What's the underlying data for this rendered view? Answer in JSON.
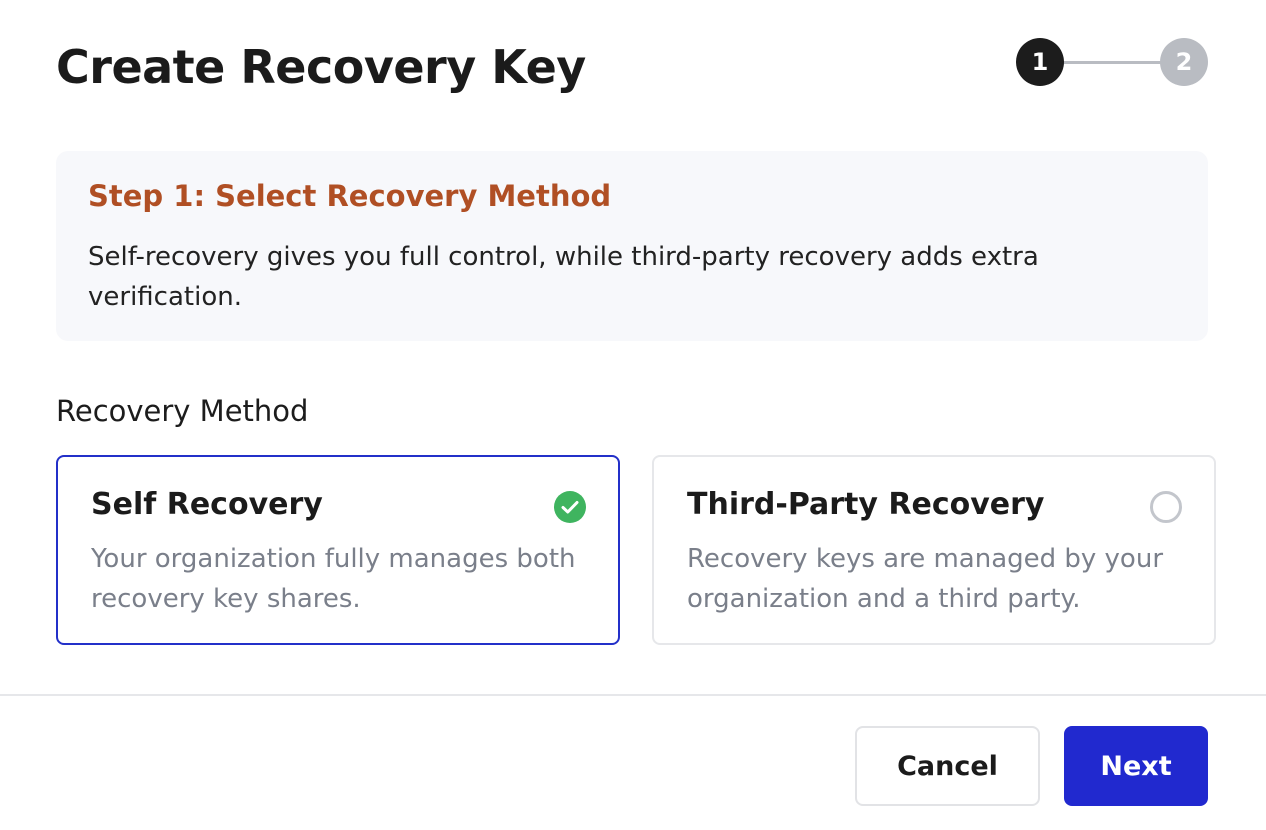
{
  "dialog": {
    "title": "Create Recovery Key"
  },
  "stepper": {
    "steps": [
      {
        "number": "1",
        "state": "active"
      },
      {
        "number": "2",
        "state": "inactive"
      }
    ]
  },
  "info": {
    "heading": "Step 1: Select Recovery Method",
    "text": "Self-recovery gives you full control, while third-party recovery adds extra verification."
  },
  "recovery_method": {
    "label": "Recovery Method",
    "options": [
      {
        "title": "Self Recovery",
        "description": "Your organization fully manages both recovery key shares.",
        "selected": true,
        "icon": "check-circle-icon"
      },
      {
        "title": "Third-Party Recovery",
        "description": "Recovery keys are managed by your organization and a third party.",
        "selected": false,
        "icon": "radio-empty-icon"
      }
    ]
  },
  "footer": {
    "cancel_label": "Cancel",
    "next_label": "Next"
  },
  "colors": {
    "accent": "#2129cf",
    "heading_accent": "#b04f24",
    "success": "#3fb45f",
    "step_active": "#1c1c1c",
    "step_inactive": "#b9bcc2"
  }
}
